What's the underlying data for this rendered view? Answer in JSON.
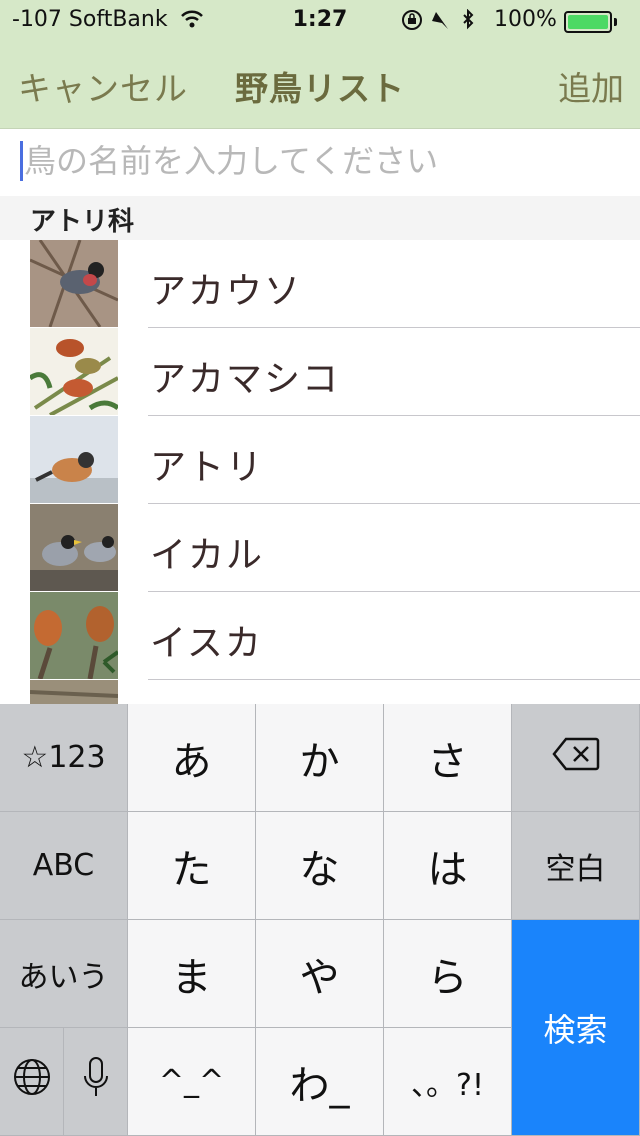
{
  "status_bar": {
    "carrier": "-107 SoftBank",
    "time": "1:27",
    "battery": "100%"
  },
  "nav": {
    "cancel": "キャンセル",
    "title": "野鳥リスト",
    "add": "追加"
  },
  "search": {
    "placeholder": "鳥の名前を入力してください",
    "value": ""
  },
  "list": {
    "section": "アトリ科",
    "items": [
      {
        "label": "アカウソ"
      },
      {
        "label": "アカマシコ"
      },
      {
        "label": "アトリ"
      },
      {
        "label": "イカル"
      },
      {
        "label": "イスカ"
      }
    ]
  },
  "keyboard": {
    "keys": {
      "num": "☆123",
      "a": "あ",
      "ka": "か",
      "sa": "さ",
      "abc": "ABC",
      "ta": "た",
      "na": "な",
      "ha": "は",
      "space": "空白",
      "aiu": "あいう",
      "ma": "ま",
      "ya": "や",
      "ra": "ら",
      "search": "検索",
      "face": "^_^",
      "wa": "わ_",
      "punct": "、。?!"
    },
    "icons": [
      "delete-icon",
      "globe-icon",
      "microphone-icon"
    ]
  }
}
